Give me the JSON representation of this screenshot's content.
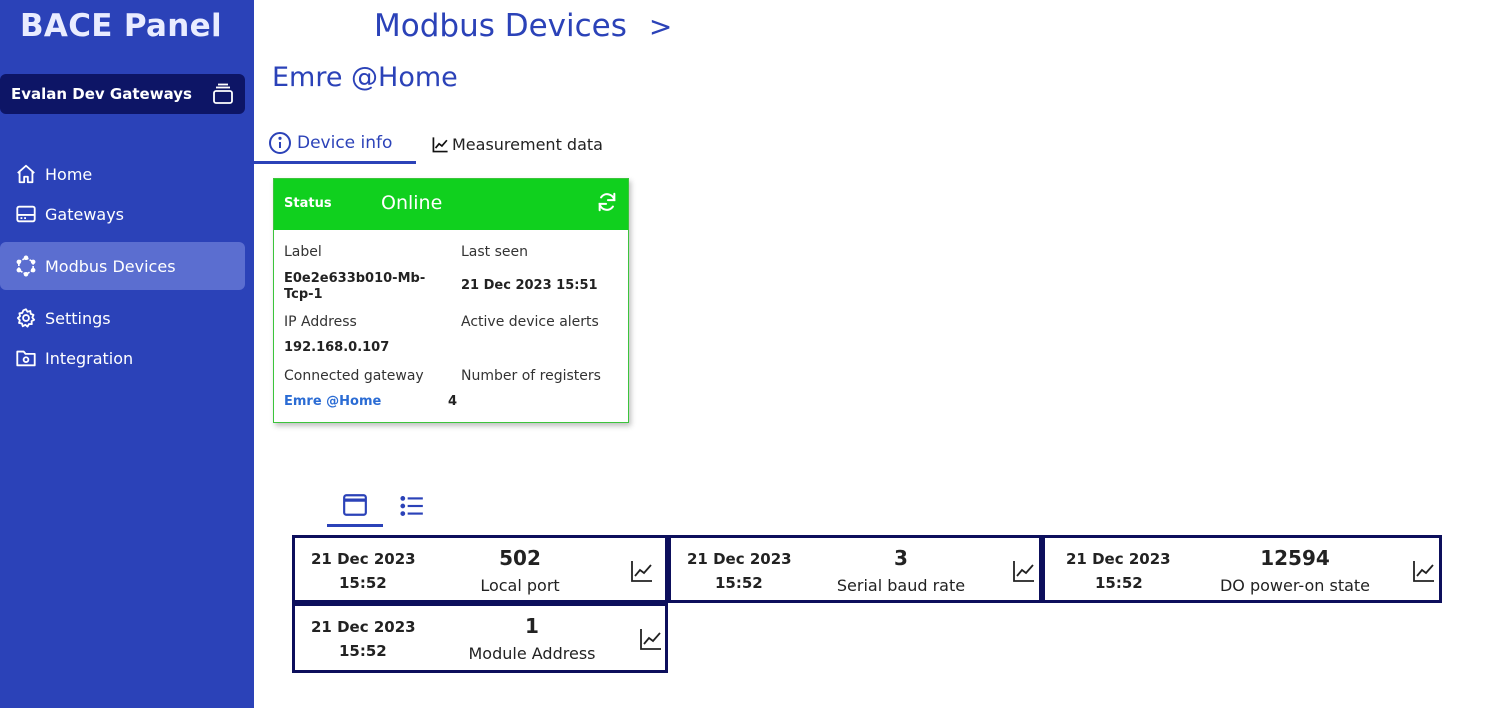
{
  "sidebar": {
    "brand": "BACE Panel",
    "gateway_selector": "Evalan Dev Gateways",
    "items": [
      {
        "label": "Home"
      },
      {
        "label": "Gateways"
      },
      {
        "label": "Modbus Devices"
      },
      {
        "label": "Settings"
      },
      {
        "label": "Integration"
      }
    ]
  },
  "header": {
    "title": "Modbus Devices",
    "separator": ">",
    "subtitle": "Emre @Home"
  },
  "tabs": [
    {
      "label": "Device info",
      "active": true
    },
    {
      "label": "Measurement data",
      "active": false
    }
  ],
  "status_card": {
    "status_label": "Status",
    "status_value": "Online",
    "status_color": "#10d01e",
    "fields": {
      "label_title": "Label",
      "label_value": "E0e2e633b010-Mb-Tcp-1",
      "last_seen_title": "Last seen",
      "last_seen_value": "21 Dec 2023 15:51",
      "ip_title": "IP Address",
      "ip_value": "192.168.0.107",
      "alerts_title": "Active device alerts",
      "gateway_title": "Connected gateway",
      "gateway_value": "Emre @Home",
      "registers_title": "Number of registers",
      "registers_value": "4"
    }
  },
  "registers": [
    {
      "date": "21 Dec 2023",
      "time": "15:52",
      "value": "502",
      "name": "Local port"
    },
    {
      "date": "21 Dec 2023",
      "time": "15:52",
      "value": "3",
      "name": "Serial baud rate"
    },
    {
      "date": "21 Dec 2023",
      "time": "15:52",
      "value": "12594",
      "name": "DO power-on state"
    },
    {
      "date": "21 Dec 2023",
      "time": "15:52",
      "value": "1",
      "name": "Module Address"
    }
  ],
  "colors": {
    "sidebar": "#2b42b8",
    "accent": "#2b42b8",
    "tile_border": "#0d0f5c",
    "online": "#10d01e",
    "link": "#2b6cd4"
  }
}
